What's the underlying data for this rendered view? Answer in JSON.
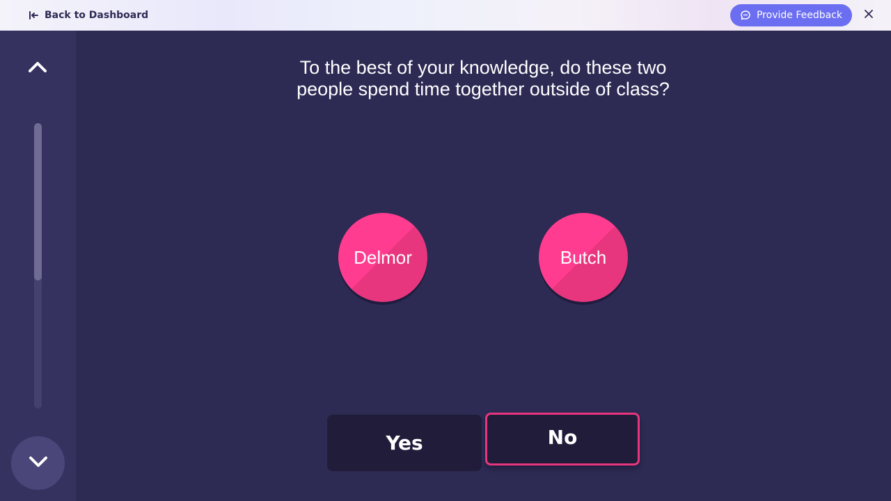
{
  "topbar": {
    "back_label": "Back to Dashboard",
    "back_icon": "arrow-left-to-line-icon",
    "feedback_label": "Provide Feedback",
    "feedback_icon": "chat-bubble-icon",
    "close_icon": "close-icon",
    "accent_color": "#6b6ef0"
  },
  "sidebar": {
    "up_icon": "chevron-up-icon",
    "down_icon": "chevron-down-icon",
    "scroll_progress": 0.55
  },
  "question": {
    "line1": "To the best of your knowledge, do these two",
    "line2": "people spend time together outside of class?"
  },
  "people": [
    {
      "name": "Delmor"
    },
    {
      "name": "Butch"
    }
  ],
  "answers": {
    "yes": "Yes",
    "no": "No",
    "selected": "No",
    "highlight_color": "#e8367e"
  }
}
